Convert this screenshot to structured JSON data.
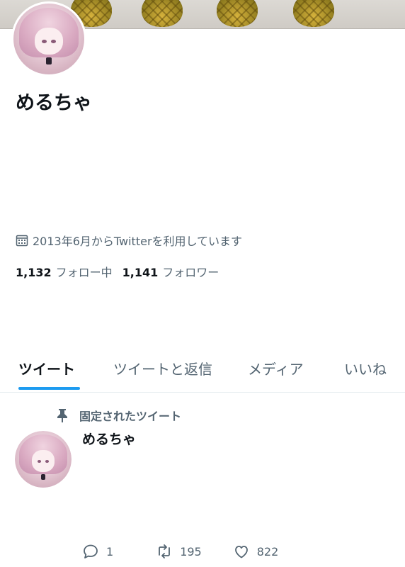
{
  "profile": {
    "display_name": "めるちゃ",
    "joined": "2013年6月からTwitterを利用しています",
    "following_count": "1,132",
    "following_label": "フォロー中",
    "followers_count": "1,141",
    "followers_label": "フォロワー"
  },
  "tabs": [
    {
      "label": "ツイート",
      "active": true
    },
    {
      "label": "ツイートと返信",
      "active": false
    },
    {
      "label": "メディア",
      "active": false
    },
    {
      "label": "いいね",
      "active": false
    }
  ],
  "pinned_tweet": {
    "pinned_label": "固定されたツイート",
    "author_name": "めるちゃ",
    "reply_count": "1",
    "retweet_count": "195",
    "like_count": "822"
  },
  "colors": {
    "accent": "#1d9bf0",
    "text": "#0f1419",
    "secondary_text": "#536471",
    "divider": "#e6ecf0"
  },
  "icons": {
    "calendar": "calendar-icon",
    "pin": "pin-icon",
    "reply": "reply-icon",
    "retweet": "retweet-icon",
    "like": "heart-icon"
  }
}
